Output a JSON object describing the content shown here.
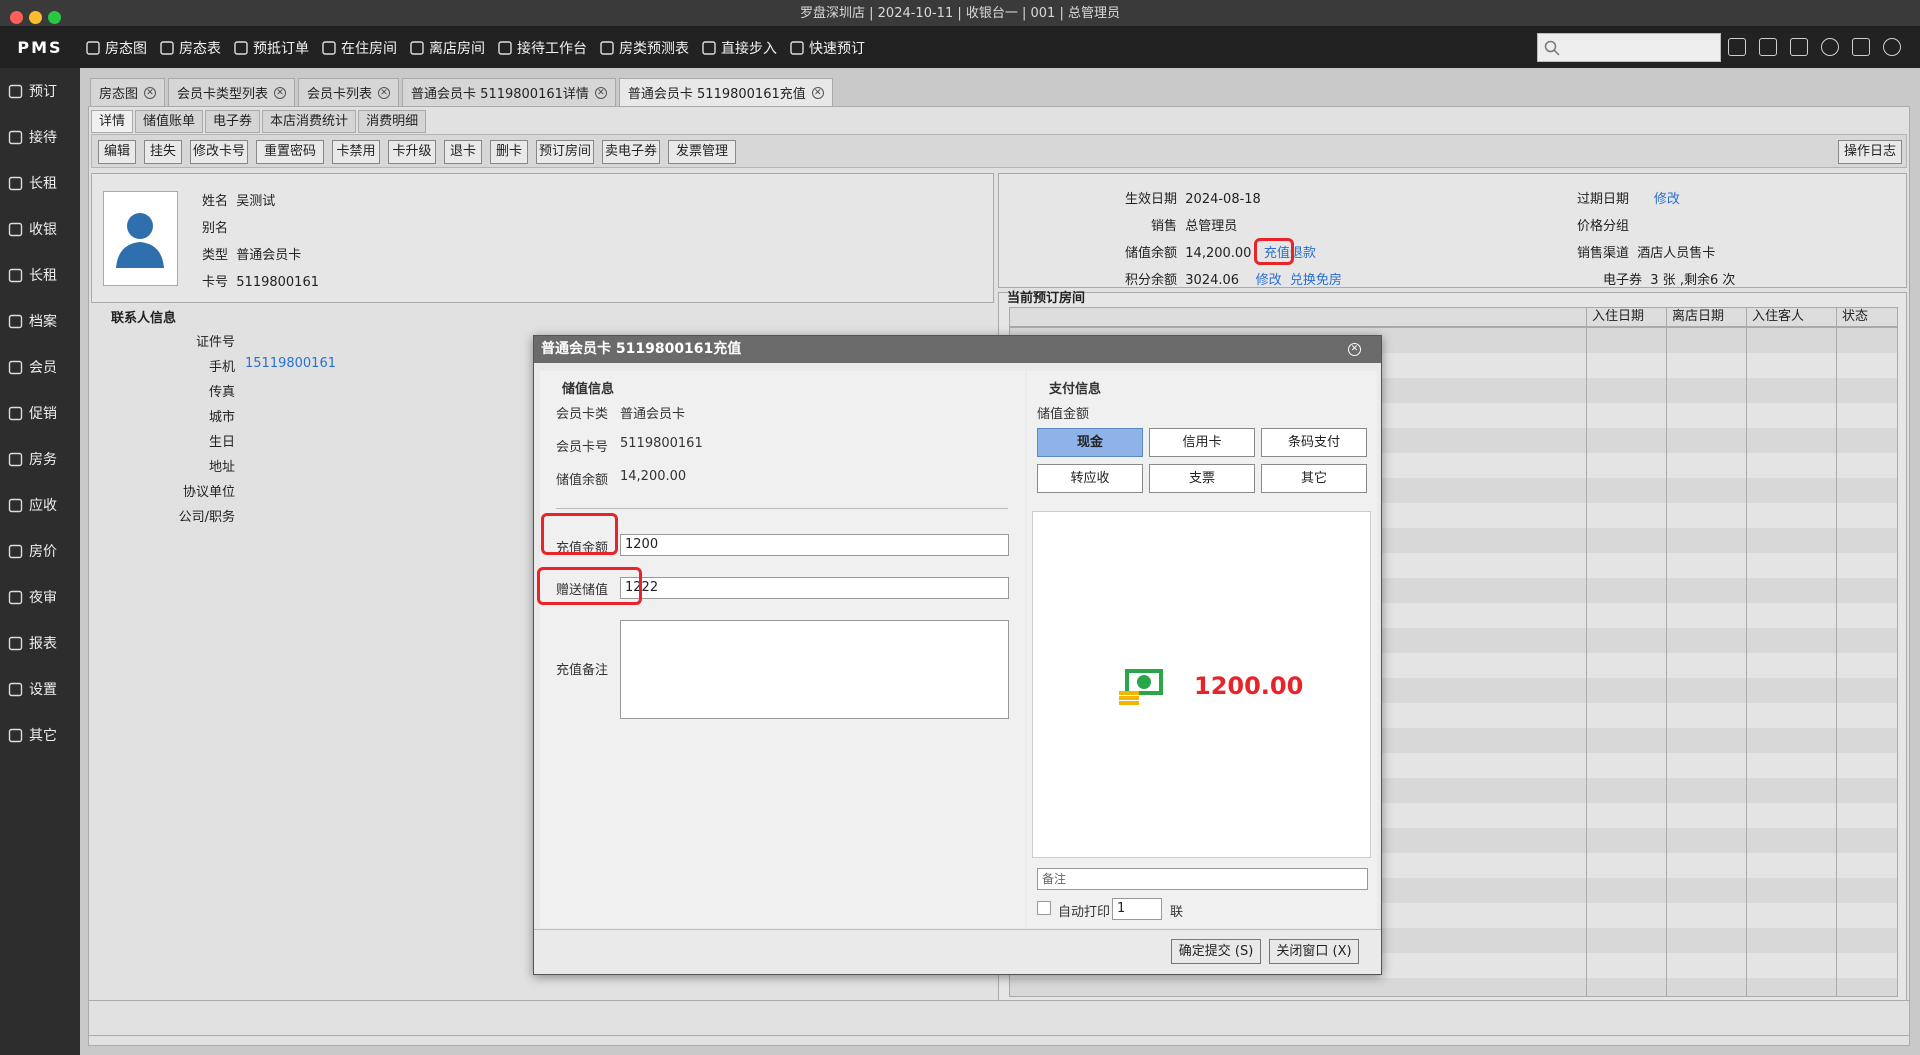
{
  "window": {
    "title": "罗盘深圳店 | 2024-10-11 | 收银台一 | 001 | 总管理员"
  },
  "topbar": {
    "logo": "PMS",
    "items": [
      {
        "label": "房态图",
        "icon": "grid-icon"
      },
      {
        "label": "房态表",
        "icon": "table-icon"
      },
      {
        "label": "预抵订单",
        "icon": "calendar-icon"
      },
      {
        "label": "在住房间",
        "icon": "home-icon"
      },
      {
        "label": "离店房间",
        "icon": "home-icon"
      },
      {
        "label": "接待工作台",
        "icon": "person-icon"
      },
      {
        "label": "房类预测表",
        "icon": "chart-icon"
      },
      {
        "label": "直接步入",
        "icon": "person-icon"
      },
      {
        "label": "快速预订",
        "icon": "bolt-icon"
      }
    ],
    "search_placeholder": ""
  },
  "sidebar": {
    "items": [
      {
        "label": "预订"
      },
      {
        "label": "接待"
      },
      {
        "label": "长租"
      },
      {
        "label": "收银"
      },
      {
        "label": "长租"
      },
      {
        "label": "档案"
      },
      {
        "label": "会员"
      },
      {
        "label": "促销"
      },
      {
        "label": "房务"
      },
      {
        "label": "应收"
      },
      {
        "label": "房价"
      },
      {
        "label": "夜审"
      },
      {
        "label": "报表"
      },
      {
        "label": "设置"
      },
      {
        "label": "其它"
      }
    ]
  },
  "tabs": [
    {
      "label": "房态图"
    },
    {
      "label": "会员卡类型列表"
    },
    {
      "label": "会员卡列表"
    },
    {
      "label": "普通会员卡 5119800161详情"
    },
    {
      "label": "普通会员卡 5119800161充值"
    }
  ],
  "subtabs": [
    "详情",
    "储值账单",
    "电子券",
    "本店消费统计",
    "消费明细"
  ],
  "toolbar": {
    "buttons": [
      "编辑",
      "挂失",
      "修改卡号",
      "重置密码",
      "卡禁用",
      "卡升级",
      "退卡",
      "删卡",
      "预订房间",
      "卖电子券",
      "发票管理"
    ],
    "log_button": "操作日志"
  },
  "member": {
    "name_label": "姓名",
    "name": "吴测试",
    "alias_label": "别名",
    "alias": "",
    "type_label": "类型",
    "type": "普通会员卡",
    "card_label": "卡号",
    "card": "5119800161"
  },
  "account": {
    "effective_label": "生效日期",
    "effective": "2024-08-18",
    "expire_label": "过期日期",
    "expire_action": "修改",
    "sales_label": "销售",
    "sales": "总管理员",
    "price_group_label": "价格分组",
    "price_group": "",
    "balance_label": "储值余额",
    "balance": "14,200.00",
    "recharge_link": "充值",
    "refund_link": "退款",
    "channel_label": "销售渠道",
    "channel": "酒店人员售卡",
    "points_label": "积分余额",
    "points": "3024.06",
    "points_edit": "修改",
    "points_exchange": "兑换免房",
    "ecoupon_label": "电子券",
    "ecoupon": "3 张 ,剩余6 次"
  },
  "contact": {
    "title": "联系人信息",
    "fields": [
      {
        "label": "证件号",
        "value": ""
      },
      {
        "label": "手机",
        "value": "15119800161"
      },
      {
        "label": "传真",
        "value": ""
      },
      {
        "label": "城市",
        "value": ""
      },
      {
        "label": "生日",
        "value": ""
      },
      {
        "label": "地址",
        "value": ""
      },
      {
        "label": "协议单位",
        "value": ""
      },
      {
        "label": "公司/职务",
        "value": ""
      }
    ]
  },
  "upcoming": {
    "title": "当前预订房间",
    "columns": [
      "入住日期",
      "离店日期",
      "入住客人",
      "状态"
    ]
  },
  "dialog": {
    "title": "普通会员卡 5119800161充值",
    "stored_title": "储值信息",
    "card_type_label": "会员卡类",
    "card_type": "普通会员卡",
    "card_no_label": "会员卡号",
    "card_no": "5119800161",
    "balance_label": "储值余额",
    "balance": "14,200.00",
    "amount_label": "充值金额",
    "amount": "1200",
    "bonus_label": "赠送储值",
    "bonus": "1222",
    "remark_label": "充值备注",
    "remark": "",
    "pay_title": "支付信息",
    "pay_amount_label": "储值金额",
    "pay_methods": [
      {
        "label": "现金",
        "selected": true
      },
      {
        "label": "信用卡",
        "selected": false
      },
      {
        "label": "条码支付",
        "selected": false
      },
      {
        "label": "转应收",
        "selected": false
      },
      {
        "label": "支票",
        "selected": false
      },
      {
        "label": "其它",
        "selected": false
      }
    ],
    "display_amount": "1200.00",
    "note_placeholder": "备注",
    "auto_print_label": "自动打印",
    "copies": "1",
    "copies_unit": "联",
    "submit": "确定提交 (S)",
    "close": "关闭窗口 (X)"
  }
}
